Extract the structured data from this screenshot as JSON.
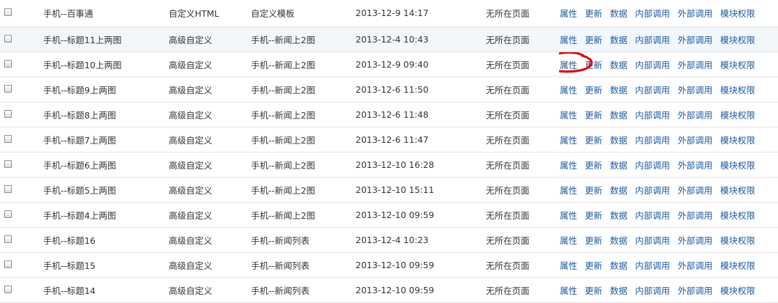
{
  "actions": {
    "props": "属性",
    "update": "更新",
    "data": "数据",
    "internal": "内部调用",
    "external": "外部调用",
    "permission": "模块权限"
  },
  "annotation_color": "#e60000",
  "rows": [
    {
      "name": "手机--百事通",
      "type": "自定义HTML",
      "template": "自定义模板",
      "date": "2013-12-9 14:17",
      "page": "无所在页面"
    },
    {
      "name": "手机--标题11上两图",
      "type": "高级自定义",
      "template": "手机--新闻上2图",
      "date": "2013-12-4 10:43",
      "page": "无所在页面"
    },
    {
      "name": "手机--标题10上两图",
      "type": "高级自定义",
      "template": "手机--新闻上2图",
      "date": "2013-12-9 09:40",
      "page": "无所在页面"
    },
    {
      "name": "手机--标题9上两图",
      "type": "高级自定义",
      "template": "手机--新闻上2图",
      "date": "2013-12-6 11:50",
      "page": "无所在页面"
    },
    {
      "name": "手机--标题8上两图",
      "type": "高级自定义",
      "template": "手机--新闻上2图",
      "date": "2013-12-6 11:48",
      "page": "无所在页面"
    },
    {
      "name": "手机--标题7上两图",
      "type": "高级自定义",
      "template": "手机--新闻上2图",
      "date": "2013-12-6 11:47",
      "page": "无所在页面"
    },
    {
      "name": "手机--标题6上两图",
      "type": "高级自定义",
      "template": "手机--新闻上2图",
      "date": "2013-12-10 16:28",
      "page": "无所在页面"
    },
    {
      "name": "手机--标题5上两图",
      "type": "高级自定义",
      "template": "手机--新闻上2图",
      "date": "2013-12-10 15:11",
      "page": "无所在页面"
    },
    {
      "name": "手机--标题4上两图",
      "type": "高级自定义",
      "template": "手机--新闻上2图",
      "date": "2013-12-10 09:59",
      "page": "无所在页面"
    },
    {
      "name": "手机--标题16",
      "type": "高级自定义",
      "template": "手机--新闻列表",
      "date": "2013-12-4 10:23",
      "page": "无所在页面"
    },
    {
      "name": "手机--标题15",
      "type": "高级自定义",
      "template": "手机--新闻列表",
      "date": "2013-12-10 09:59",
      "page": "无所在页面"
    },
    {
      "name": "手机--标题14",
      "type": "高级自定义",
      "template": "手机--新闻列表",
      "date": "2013-12-10 09:59",
      "page": "无所在页面"
    }
  ]
}
